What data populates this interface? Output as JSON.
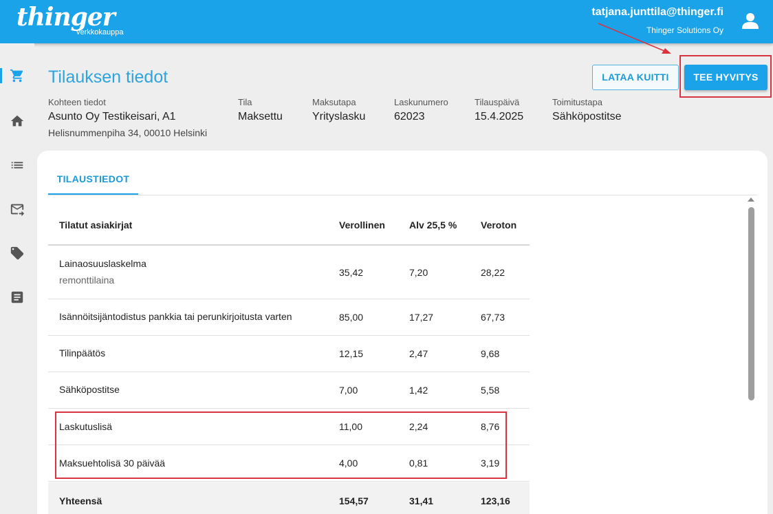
{
  "app": {
    "logo": "thinger",
    "logo_sub": "verkkokauppa",
    "user_email": "tatjana.junttila@thinger.fi",
    "user_company": "Thinger Solutions Oy"
  },
  "sidebar": {
    "items": [
      {
        "icon": "cart-icon",
        "active": true
      },
      {
        "icon": "home-icon",
        "active": false
      },
      {
        "icon": "list-icon",
        "active": false
      },
      {
        "icon": "mail-forward-icon",
        "active": false
      },
      {
        "icon": "tag-icon",
        "active": false
      },
      {
        "icon": "document-icon",
        "active": false
      }
    ]
  },
  "page": {
    "title": "Tilauksen tiedot",
    "btn_download": "LATAA KUITTI",
    "btn_refund": "TEE HYVITYS"
  },
  "info": {
    "target_label": "Kohteen tiedot",
    "target_value": "Asunto Oy Testikeisari, A1",
    "target_address": "Helisnummenpiha 34, 00010 Helsinki",
    "status_label": "Tila",
    "status_value": "Maksettu",
    "payment_label": "Maksutapa",
    "payment_value": "Yrityslasku",
    "invoice_label": "Laskunumero",
    "invoice_value": "62023",
    "date_label": "Tilauspäivä",
    "date_value": "15.4.2025",
    "delivery_label": "Toimitustapa",
    "delivery_value": "Sähköpostitse"
  },
  "tabs": {
    "active": "TILAUSTIEDOT"
  },
  "table": {
    "headers": [
      "Tilatut asiakirjat",
      "Verollinen",
      "Alv 25,5 %",
      "Veroton"
    ],
    "rows": [
      {
        "name": "Lainaosuuslaskelma",
        "note": "remonttilaina",
        "gross": "35,42",
        "vat": "7,20",
        "net": "28,22"
      },
      {
        "name": "Isännöitsijäntodistus pankkia tai perunkirjoitusta varten",
        "gross": "85,00",
        "vat": "17,27",
        "net": "67,73"
      },
      {
        "name": "Tilinpäätös",
        "gross": "12,15",
        "vat": "2,47",
        "net": "9,68"
      },
      {
        "name": "Sähköpostitse",
        "gross": "7,00",
        "vat": "1,42",
        "net": "5,58"
      },
      {
        "name": "Laskutuslisä",
        "gross": "11,00",
        "vat": "2,24",
        "net": "8,76"
      },
      {
        "name": "Maksuehtolisä 30 päivää",
        "gross": "4,00",
        "vat": "0,81",
        "net": "3,19"
      }
    ],
    "total": {
      "name": "Yhteensä",
      "gross": "154,57",
      "vat": "31,41",
      "net": "123,16"
    }
  },
  "colors": {
    "brand": "#1aa3e8",
    "annotation": "#d9333f"
  }
}
